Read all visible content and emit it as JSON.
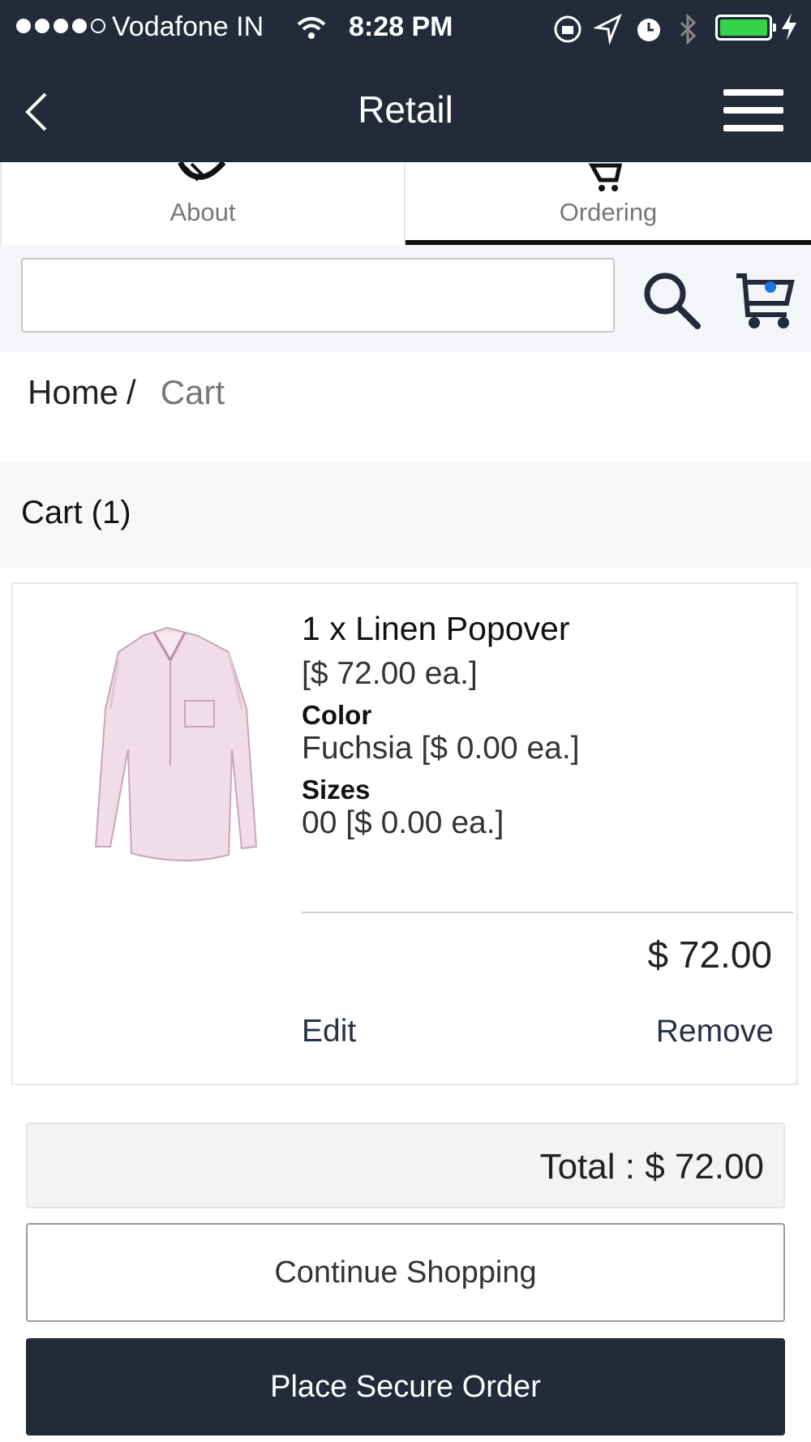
{
  "status_bar": {
    "carrier": "Vodafone IN",
    "time": "8:28 PM",
    "icons": [
      "wifi-icon",
      "rotation-lock-icon",
      "location-icon",
      "alarm-icon",
      "bluetooth-icon",
      "battery-icon",
      "charging-icon"
    ],
    "battery_level": 1.0
  },
  "nav": {
    "title": "Retail",
    "back_icon": "chevron-left-icon",
    "menu_icon": "hamburger-menu-icon"
  },
  "tabs": [
    {
      "label": "About",
      "icon": "handshake-icon",
      "active": false
    },
    {
      "label": "Ordering",
      "icon": "cart-icon",
      "active": true
    }
  ],
  "search": {
    "value": "",
    "placeholder": "",
    "search_icon": "search-icon",
    "cart_icon": "shopping-cart-icon"
  },
  "breadcrumb": {
    "home": "Home",
    "separator": "/",
    "current": "Cart"
  },
  "cart": {
    "title": "Cart (1)",
    "items": [
      {
        "name": "1 x Linen Popover",
        "price_each": "[$ 72.00 ea.]",
        "options": [
          {
            "label": "Color",
            "value": "Fuchsia [$ 0.00 ea.]"
          },
          {
            "label": "Sizes",
            "value": "00 [$ 0.00 ea.]"
          }
        ],
        "line_total": "$ 72.00",
        "edit_label": "Edit",
        "remove_label": "Remove"
      }
    ],
    "total": "Total : $ 72.00",
    "continue_label": "Continue Shopping",
    "order_label": "Place Secure Order"
  },
  "colors": {
    "header_bg": "#232b3a",
    "accent_dot": "#1a73e8",
    "battery": "#35d24a"
  }
}
